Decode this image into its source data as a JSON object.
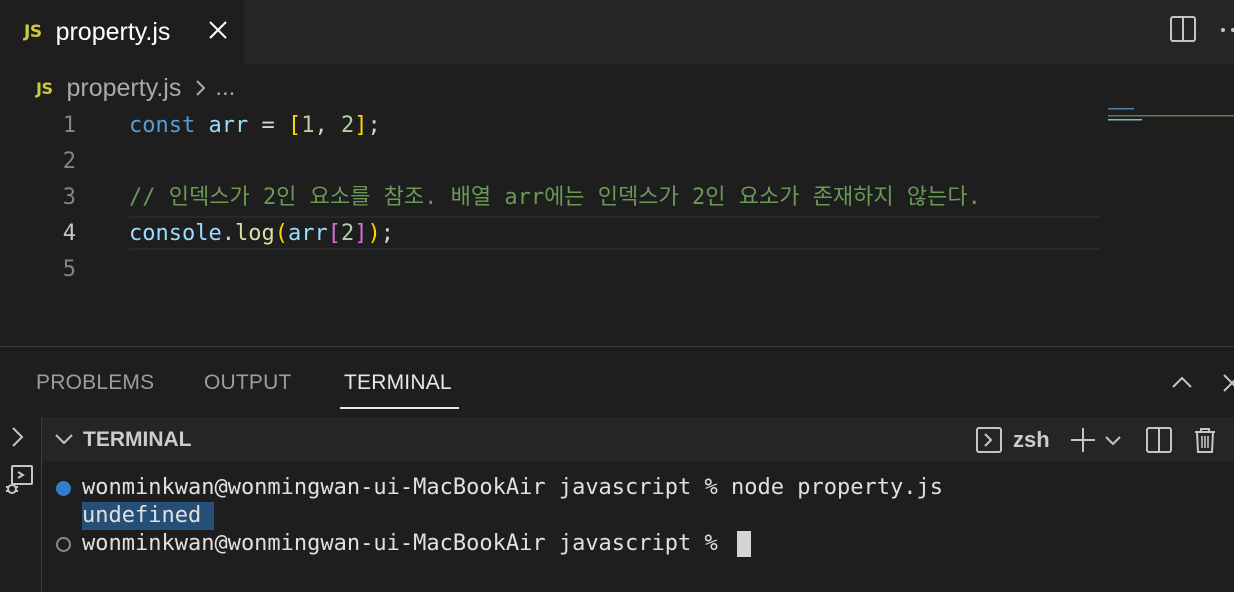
{
  "tab": {
    "badge": "JS",
    "title": "property.js"
  },
  "breadcrumb": {
    "badge": "JS",
    "file": "property.js",
    "ellipsis": "..."
  },
  "editor": {
    "line_numbers": [
      "1",
      "2",
      "3",
      "4",
      "5"
    ],
    "active_line": 4,
    "line1": {
      "kw": "const",
      "var": "arr",
      "eq": " = ",
      "open": "[",
      "n1": "1",
      "comma": ", ",
      "n2": "2",
      "close": "]",
      "semi": ";"
    },
    "line3": {
      "comment": "// 인덱스가 2인 요소를 참조. 배열 arr에는 인덱스가 2인 요소가 존재하지 않는다."
    },
    "line4": {
      "obj": "console",
      "dot": ".",
      "fn": "log",
      "open": "(",
      "var": "arr",
      "bopen": "[",
      "idx": "2",
      "bclose": "]",
      "close": ")",
      "semi": ";"
    }
  },
  "panel": {
    "tabs": [
      "PROBLEMS",
      "OUTPUT",
      "TERMINAL"
    ],
    "active_tab": "TERMINAL",
    "terminal_title": "TERMINAL",
    "shell": "zsh",
    "lines": {
      "prompt1": "wonminkwan@wonmingwan-ui-MacBookAir javascript % node property.js",
      "output": "undefined ",
      "prompt2": "wonminkwan@wonmingwan-ui-MacBookAir javascript % "
    }
  },
  "colors": {
    "keyword": "#569cd6",
    "variable": "#9cdcfe",
    "comment": "#6a9955",
    "function": "#dcdcaa",
    "number": "#b5cea8",
    "bracket_gold": "#ffd700",
    "bracket_purple": "#da70d6",
    "js_badge": "#cbcb41"
  },
  "icons": {
    "tab_close": "close-icon",
    "split_editor": "split-editor-icon",
    "more_actions": "more-icon",
    "breadcrumb_sep": "chevron-right-icon",
    "panel_maximize": "chevron-up-icon",
    "panel_close": "close-icon",
    "terminal_collapse": "chevron-down-icon",
    "shell": "terminal-icon",
    "new_terminal": "plus-icon",
    "terminal_dropdown": "chevron-down-icon",
    "split_terminal": "split-terminal-icon",
    "kill_terminal": "trash-icon",
    "side_toggle": "chevron-right-icon",
    "debug_console": "debug-console-icon"
  }
}
